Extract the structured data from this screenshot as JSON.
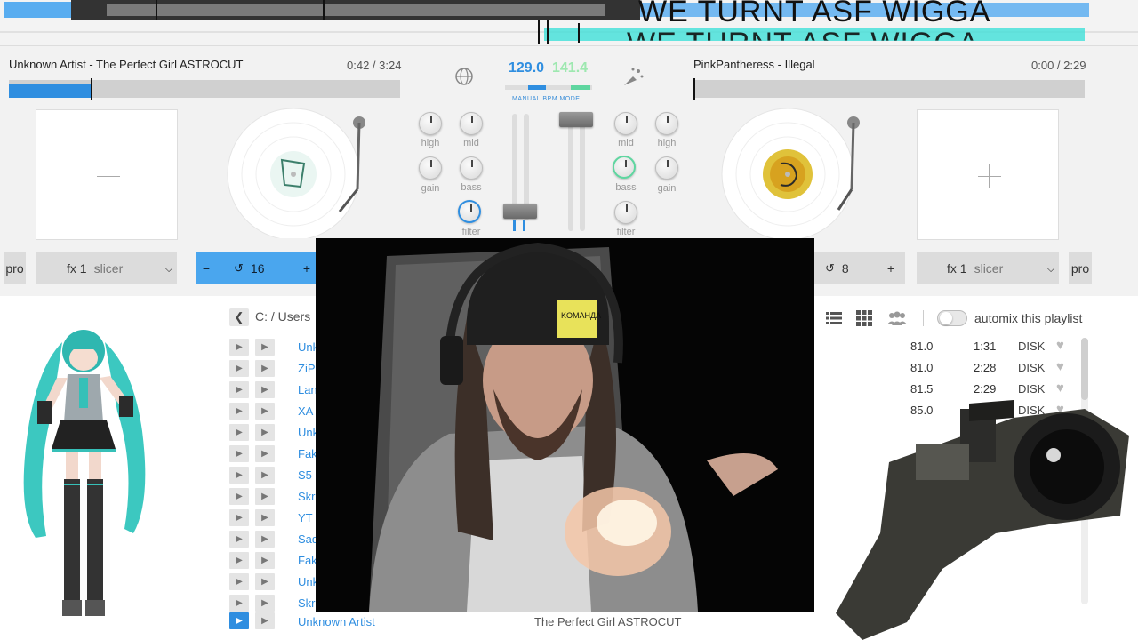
{
  "overlay": {
    "caption": "WE TURNT ASF WIGGA",
    "caption2": "WE TURNT ASF WIGGA"
  },
  "left_deck": {
    "title": "Unknown Artist - The Perfect Girl ASTROCUT",
    "time": "0:42 / 3:24",
    "loop_value": "16",
    "fx_label": "fx 1",
    "fx_effect": "slicer",
    "pro_label": "pro",
    "minus": "−",
    "plus": "+",
    "progress": 0.21
  },
  "right_deck": {
    "title": "PinkPantheress - Illegal",
    "time": "0:00 / 2:29",
    "loop_value": "8",
    "fx_label": "fx 1",
    "fx_effect": "slicer",
    "pro_label": "pro",
    "plus": "+",
    "progress": 0.0
  },
  "mixer": {
    "bpm": "129.0",
    "bpm_alt": "141.4",
    "mode": "MANUAL BPM MODE",
    "left_knobs": {
      "high": "high",
      "mid": "mid",
      "gain": "gain",
      "bass": "bass",
      "filter": "filter"
    },
    "right_knobs": {
      "mid": "mid",
      "high": "high",
      "bass": "bass",
      "gain": "gain",
      "filter": "filter"
    }
  },
  "library": {
    "breadcrumb": "C: / Users",
    "automix_label": "automix this playlist",
    "artists": [
      "Unk",
      "ZiP",
      "Lan",
      "XA",
      "Unk",
      "Fak",
      "S5",
      "Skr",
      "YT",
      "Sad",
      "Fak",
      "Unk",
      "Skr"
    ],
    "now_playing_artist": "Unknown Artist",
    "now_playing_title": "The Perfect Girl ASTROCUT",
    "right_rows": [
      {
        "bpm": "81.0",
        "length": "1:31",
        "source": "DISK"
      },
      {
        "bpm": "81.0",
        "length": "2:28",
        "source": "DISK"
      },
      {
        "bpm": "81.5",
        "length": "2:29",
        "source": "DISK"
      },
      {
        "bpm": "85.0",
        "length": "",
        "source": "DISK"
      }
    ]
  },
  "colors": {
    "accent": "#2f8ee0",
    "accent_green": "#5fd6a0",
    "waveform_cyan": "#3fe0d8"
  }
}
